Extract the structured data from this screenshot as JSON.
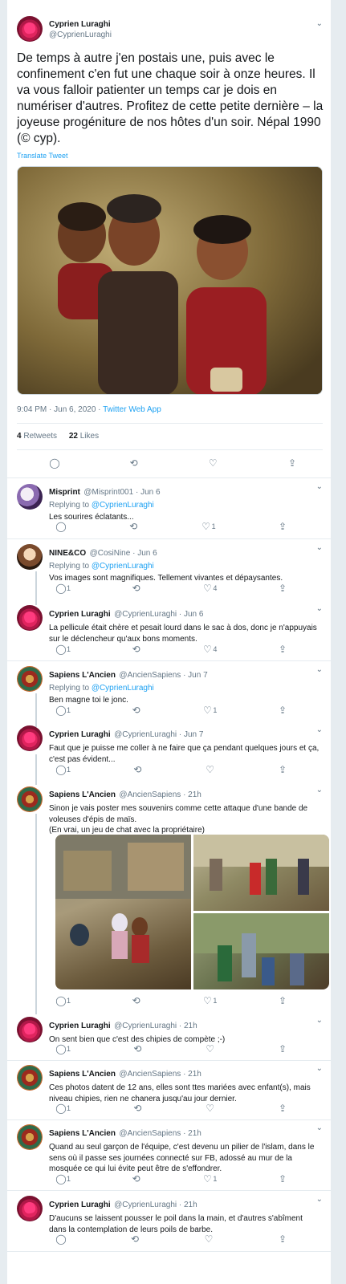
{
  "main_tweet": {
    "author_name": "Cyprien Luraghi",
    "author_handle": "@CyprienLuraghi",
    "text": "De temps à autre j'en postais une, puis avec le confinement c'en fut une chaque soir à onze heures. Il va vous falloir patienter un temps car je dois en numériser d'autres. Profitez de cette petite dernière – la joyeuse progéniture de nos hôtes d'un soir. Népal 1990 (© cyp).",
    "translate_label": "Translate Tweet",
    "timestamp": "9:04 PM · Jun 6, 2020 ·",
    "source": "Twitter Web App",
    "retweets_count": "4",
    "retweets_label": "Retweets",
    "likes_count": "22",
    "likes_label": "Likes"
  },
  "icons": {
    "reply": "reply-icon",
    "retweet": "retweet-icon",
    "like": "heart-icon",
    "share": "share-icon",
    "caret": "chevron-down-icon"
  },
  "replies": [
    {
      "name": "Misprint",
      "handle": "@Misprint001 · Jun 6",
      "replying_prefix": "Replying to",
      "replying_to": "@CyprienLuraghi",
      "text": "Les sourires éclatants...",
      "reply_count": "",
      "retweet_count": "",
      "like_count": "1"
    },
    {
      "name": "NINE&CO",
      "handle": "@CosiNine · Jun 6",
      "replying_prefix": "Replying to",
      "replying_to": "@CyprienLuraghi",
      "text": "Vos images sont magnifiques. Tellement vivantes et dépaysantes.",
      "reply_count": "1",
      "retweet_count": "",
      "like_count": "4"
    },
    {
      "name": "Cyprien Luraghi",
      "handle": "@CyprienLuraghi · Jun 6",
      "text": "La pellicule était chère et pesait lourd dans le sac à dos, donc je n'appuyais sur le déclencheur qu'aux bons moments.",
      "reply_count": "1",
      "retweet_count": "",
      "like_count": "4"
    },
    {
      "name": "Sapiens L'Ancien",
      "handle": "@AncienSapiens · Jun 7",
      "replying_prefix": "Replying to",
      "replying_to": "@CyprienLuraghi",
      "text": "Ben magne toi le jonc.",
      "reply_count": "1",
      "retweet_count": "",
      "like_count": "1"
    },
    {
      "name": "Cyprien Luraghi",
      "handle": "@CyprienLuraghi · Jun 7",
      "text": "Faut que je puisse me coller à ne faire que ça pendant quelques jours et ça, c'est pas évident...",
      "reply_count": "1",
      "retweet_count": "",
      "like_count": ""
    },
    {
      "name": "Sapiens L'Ancien",
      "handle": "@AncienSapiens · 21h",
      "text": "Sinon je vais poster mes souvenirs comme cette attaque d'une bande de voleuses d'épis de maïs.\n(En vrai, un jeu de chat avec la propriétaire)",
      "reply_count": "1",
      "retweet_count": "",
      "like_count": "1"
    },
    {
      "name": "Cyprien Luraghi",
      "handle": "@CyprienLuraghi · 21h",
      "text": "On sent bien que c'est des chipies de compète ;-)",
      "reply_count": "1",
      "retweet_count": "",
      "like_count": ""
    },
    {
      "name": "Sapiens L'Ancien",
      "handle": "@AncienSapiens · 21h",
      "text": "Ces photos datent de 12 ans, elles sont ttes mariées avec enfant(s), mais niveau chipies, rien ne chanera jusqu'au jour dernier.",
      "reply_count": "1",
      "retweet_count": "",
      "like_count": ""
    },
    {
      "name": "Sapiens L'Ancien",
      "handle": "@AncienSapiens · 21h",
      "text": "Quand au seul garçon de l'équipe, c'est devenu un pilier de l'islam, dans le sens où il passe ses journées connecté sur FB, adossé au mur de la mosquée ce qui lui évite peut être de s'effondrer.",
      "reply_count": "1",
      "retweet_count": "",
      "like_count": "1"
    },
    {
      "name": "Cyprien Luraghi",
      "handle": "@CyprienLuraghi · 21h",
      "text": "D'aucuns se laissent pousser le poil dans la main, et d'autres s'abîment dans la contemplation de leurs poils de barbe.",
      "reply_count": "",
      "retweet_count": "",
      "like_count": ""
    }
  ],
  "colors": {
    "accent": "#1da1f2",
    "text": "#14171a",
    "muted": "#657786",
    "border": "#e6ecf0"
  }
}
